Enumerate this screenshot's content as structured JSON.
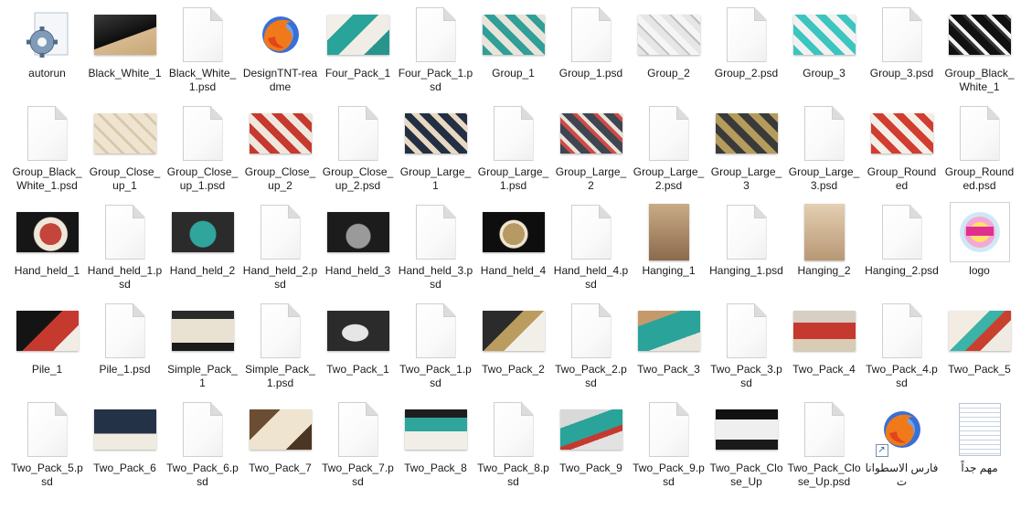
{
  "files": [
    {
      "label": "autorun",
      "icon": "gear-document-icon"
    },
    {
      "label": "Black_White_1",
      "icon": "image-thumbnail",
      "thumb": "p-black"
    },
    {
      "label": "Black_White_1.psd",
      "icon": "blank-file-icon"
    },
    {
      "label": "DesignTNT-readme",
      "icon": "firefox-icon"
    },
    {
      "label": "Four_Pack_1",
      "icon": "image-thumbnail",
      "thumb": "p-teal"
    },
    {
      "label": "Four_Pack_1.psd",
      "icon": "blank-file-icon"
    },
    {
      "label": "Group_1",
      "icon": "image-thumbnail",
      "thumb": "p-teal2"
    },
    {
      "label": "Group_1.psd",
      "icon": "blank-file-icon"
    },
    {
      "label": "Group_2",
      "icon": "image-thumbnail",
      "thumb": "p-gray"
    },
    {
      "label": "Group_2.psd",
      "icon": "blank-file-icon"
    },
    {
      "label": "Group_3",
      "icon": "image-thumbnail",
      "thumb": "p-cyan"
    },
    {
      "label": "Group_3.psd",
      "icon": "blank-file-icon"
    },
    {
      "label": "Group_Black_White_1",
      "icon": "image-thumbnail",
      "thumb": "p-dark"
    },
    {
      "label": "Group_Black_White_1.psd",
      "icon": "blank-file-icon"
    },
    {
      "label": "Group_Close_up_1",
      "icon": "image-thumbnail",
      "thumb": "p-cream"
    },
    {
      "label": "Group_Close_up_1.psd",
      "icon": "blank-file-icon"
    },
    {
      "label": "Group_Close_up_2",
      "icon": "image-thumbnail",
      "thumb": "p-red"
    },
    {
      "label": "Group_Close_up_2.psd",
      "icon": "blank-file-icon"
    },
    {
      "label": "Group_Large_1",
      "icon": "image-thumbnail",
      "thumb": "p-navy"
    },
    {
      "label": "Group_Large_1.psd",
      "icon": "blank-file-icon"
    },
    {
      "label": "Group_Large_2",
      "icon": "image-thumbnail",
      "thumb": "p-slate"
    },
    {
      "label": "Group_Large_2.psd",
      "icon": "blank-file-icon"
    },
    {
      "label": "Group_Large_3",
      "icon": "image-thumbnail",
      "thumb": "p-olive"
    },
    {
      "label": "Group_Large_3.psd",
      "icon": "blank-file-icon"
    },
    {
      "label": "Group_Rounded",
      "icon": "image-thumbnail",
      "thumb": "p-redround"
    },
    {
      "label": "Group_Rounded.psd",
      "icon": "blank-file-icon"
    },
    {
      "label": "Hand_held_1",
      "icon": "image-thumbnail",
      "thumb": "p-hand1"
    },
    {
      "label": "Hand_held_1.psd",
      "icon": "blank-file-icon"
    },
    {
      "label": "Hand_held_2",
      "icon": "image-thumbnail",
      "thumb": "p-hand2"
    },
    {
      "label": "Hand_held_2.psd",
      "icon": "blank-file-icon"
    },
    {
      "label": "Hand_held_3",
      "icon": "image-thumbnail",
      "thumb": "p-hand3"
    },
    {
      "label": "Hand_held_3.psd",
      "icon": "blank-file-icon"
    },
    {
      "label": "Hand_held_4",
      "icon": "image-thumbnail",
      "thumb": "p-hand4"
    },
    {
      "label": "Hand_held_4.psd",
      "icon": "blank-file-icon"
    },
    {
      "label": "Hanging_1",
      "icon": "image-thumbnail-tall",
      "thumb": "p-hang1"
    },
    {
      "label": "Hanging_1.psd",
      "icon": "blank-file-icon"
    },
    {
      "label": "Hanging_2",
      "icon": "image-thumbnail-tall",
      "thumb": "p-hang2"
    },
    {
      "label": "Hanging_2.psd",
      "icon": "blank-file-icon"
    },
    {
      "label": "logo",
      "icon": "logo-image-icon"
    },
    {
      "label": "Pile_1",
      "icon": "image-thumbnail",
      "thumb": "p-pile"
    },
    {
      "label": "Pile_1.psd",
      "icon": "blank-file-icon"
    },
    {
      "label": "Simple_Pack_1",
      "icon": "image-thumbnail",
      "thumb": "p-simple"
    },
    {
      "label": "Simple_Pack_1.psd",
      "icon": "blank-file-icon"
    },
    {
      "label": "Two_Pack_1",
      "icon": "image-thumbnail",
      "thumb": "p-tp1"
    },
    {
      "label": "Two_Pack_1.psd",
      "icon": "blank-file-icon"
    },
    {
      "label": "Two_Pack_2",
      "icon": "image-thumbnail",
      "thumb": "p-tp2"
    },
    {
      "label": "Two_Pack_2.psd",
      "icon": "blank-file-icon"
    },
    {
      "label": "Two_Pack_3",
      "icon": "image-thumbnail",
      "thumb": "p-tp3"
    },
    {
      "label": "Two_Pack_3.psd",
      "icon": "blank-file-icon"
    },
    {
      "label": "Two_Pack_4",
      "icon": "image-thumbnail",
      "thumb": "p-tp4"
    },
    {
      "label": "Two_Pack_4.psd",
      "icon": "blank-file-icon"
    },
    {
      "label": "Two_Pack_5",
      "icon": "image-thumbnail",
      "thumb": "p-tp5"
    },
    {
      "label": "Two_Pack_5.psd",
      "icon": "blank-file-icon"
    },
    {
      "label": "Two_Pack_6",
      "icon": "image-thumbnail",
      "thumb": "p-tp6"
    },
    {
      "label": "Two_Pack_6.psd",
      "icon": "blank-file-icon"
    },
    {
      "label": "Two_Pack_7",
      "icon": "image-thumbnail",
      "thumb": "p-tp7"
    },
    {
      "label": "Two_Pack_7.psd",
      "icon": "blank-file-icon"
    },
    {
      "label": "Two_Pack_8",
      "icon": "image-thumbnail",
      "thumb": "p-tp8"
    },
    {
      "label": "Two_Pack_8.psd",
      "icon": "blank-file-icon"
    },
    {
      "label": "Two_Pack_9",
      "icon": "image-thumbnail",
      "thumb": "p-tp9"
    },
    {
      "label": "Two_Pack_9.psd",
      "icon": "blank-file-icon"
    },
    {
      "label": "Two_Pack_Close_Up",
      "icon": "image-thumbnail",
      "thumb": "p-tpc"
    },
    {
      "label": "Two_Pack_Close_Up.psd",
      "icon": "blank-file-icon"
    },
    {
      "label": "فارس الاسطوانات",
      "icon": "firefox-shortcut-icon"
    },
    {
      "label": "مهم جداً",
      "icon": "text-document-icon"
    }
  ]
}
